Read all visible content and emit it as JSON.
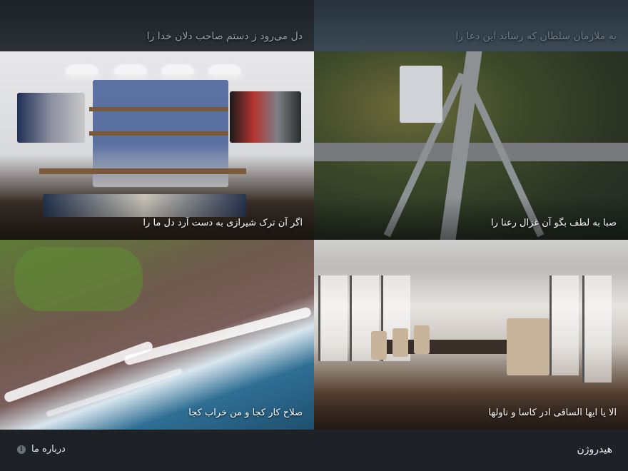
{
  "tiles": {
    "top_left": {
      "caption": "دل می‌رود ز دستم صاحب دلان خدا را"
    },
    "top_right": {
      "caption": "به ملازمان سلطان که رساند این دعا را"
    },
    "store": {
      "caption": "اگر آن ترک شیرازی به دست آرد دل ما را"
    },
    "highway": {
      "caption": "صبا به لطف بگو آن غزال رعنا را"
    },
    "coast": {
      "caption": "صلاح کار کجا و من خراب کجا"
    },
    "conference": {
      "caption": "الا یا ایها الساقی ادر کاسا و ناولها"
    }
  },
  "footer": {
    "brand": "هیدروژن",
    "about_label": "درباره ما",
    "about_icon": "info-icon"
  }
}
